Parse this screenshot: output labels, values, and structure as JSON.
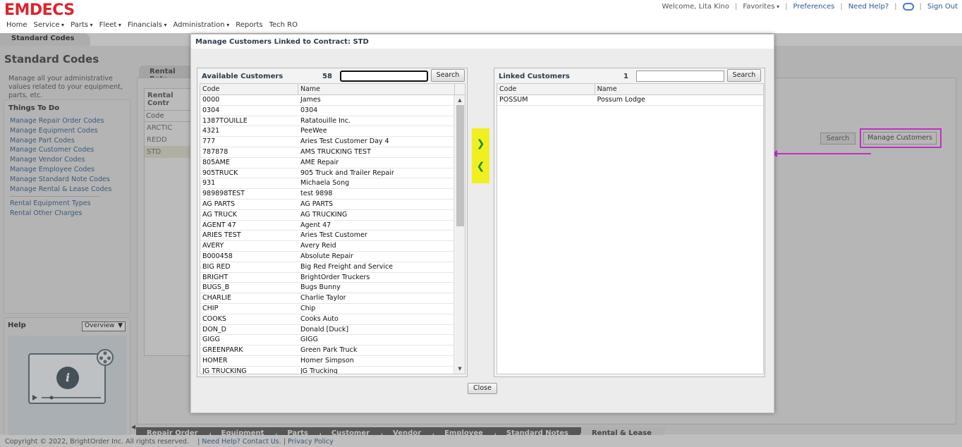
{
  "app": {
    "logo": "EMDECS",
    "nav": [
      {
        "label": "Home",
        "dropdown": false
      },
      {
        "label": "Service",
        "dropdown": true
      },
      {
        "label": "Parts",
        "dropdown": true
      },
      {
        "label": "Fleet",
        "dropdown": true
      },
      {
        "label": "Financials",
        "dropdown": true
      },
      {
        "label": "Administration",
        "dropdown": true
      },
      {
        "label": "Reports",
        "dropdown": false
      },
      {
        "label": "Tech RO",
        "dropdown": false
      }
    ],
    "user": {
      "welcome": "Welcome, Lita Kino",
      "favorites": "Favorites",
      "preferences": "Preferences",
      "need_help": "Need Help?",
      "sign_out": "Sign Out",
      "sep": "|"
    }
  },
  "page": {
    "tab": "Standard Codes",
    "title": "Standard Codes",
    "description": "Manage all your administrative values related to your equipment, parts, etc.",
    "things_to_do": {
      "heading": "Things To Do",
      "links": [
        "Manage Repair Order Codes",
        "Manage Equipment Codes",
        "Manage Part Codes",
        "Manage Customer Codes",
        "Manage Vendor Codes",
        "Manage Employee Codes",
        "Manage Standard Note Codes",
        "Manage Rental & Lease Codes"
      ],
      "links2": [
        "Rental Equipment Types",
        "Rental Other Charges"
      ]
    },
    "help": {
      "title": "Help",
      "select_value": "Overview"
    },
    "rate_tab": "Rental Rate",
    "contract_list": {
      "heading": "Rental Contr",
      "column": "Code",
      "rows": [
        "ARCTIC",
        "REDD",
        "STD"
      ],
      "selected_index": 2
    },
    "search_label": "Search",
    "manage_customers_label": "Manage Customers",
    "bottom_tabs": [
      "Repair Order",
      "Equipment",
      "Parts",
      "Customer",
      "Vendor",
      "Employee",
      "Standard Notes",
      "Rental & Lease"
    ],
    "bottom_tab_active": "Rental & Lease"
  },
  "footer": {
    "copyright": "Copyright © 2022, BrightOrder Inc. All rights reserved.",
    "contact": "Need Help? Contact Us.",
    "privacy": "Privacy Policy",
    "sep": "|"
  },
  "modal": {
    "title": "Manage Customers Linked to Contract: STD",
    "available": {
      "title": "Available Customers",
      "count": "58",
      "search_value": "",
      "search_label": "Search",
      "columns": [
        "Code",
        "Name"
      ],
      "rows": [
        [
          "0000",
          "James"
        ],
        [
          "0304",
          "0304"
        ],
        [
          "1387TOUILLE",
          "Ratatouille Inc."
        ],
        [
          "4321",
          "PeeWee"
        ],
        [
          "777",
          "Aries Test Customer Day 4"
        ],
        [
          "787878",
          "AMS TRUCKING TEST"
        ],
        [
          "805AME",
          "AME Repair"
        ],
        [
          "905TRUCK",
          "905 Truck and Trailer Repair"
        ],
        [
          "931",
          "Michaela Song"
        ],
        [
          "989898TEST",
          "test 9898"
        ],
        [
          "AG PARTS",
          "AG PARTS"
        ],
        [
          "AG TRUCK",
          "AG TRUCKING"
        ],
        [
          "AGENT 47",
          "Agent 47"
        ],
        [
          "ARIES TEST",
          "Aries Test Customer"
        ],
        [
          "AVERY",
          "Avery Reid"
        ],
        [
          "B000458",
          "Absolute Repair"
        ],
        [
          "BIG RED",
          "Big Red Freight and Service"
        ],
        [
          "BRIGHT",
          "BrightOrder Truckers"
        ],
        [
          "BUGS_B",
          "Bugs Bunny"
        ],
        [
          "CHARLIE",
          "Charlie Taylor"
        ],
        [
          "CHIP",
          "Chip"
        ],
        [
          "COOKS",
          "Cooks Auto"
        ],
        [
          "DON_D",
          "Donald [Duck]"
        ],
        [
          "GIGG",
          "GIGG"
        ],
        [
          "GREENPARK",
          "Green Park Truck"
        ],
        [
          "HOMER",
          "Homer Simpson"
        ],
        [
          "JG TRUCKING",
          "JG Trucking"
        ]
      ]
    },
    "linked": {
      "title": "Linked Customers",
      "count": "1",
      "search_value": "",
      "search_label": "Search",
      "columns": [
        "Code",
        "Name"
      ],
      "rows": [
        [
          "POSSUM",
          "Possum Lodge"
        ]
      ]
    },
    "move_right_icon": "chevron-right-icon",
    "move_left_icon": "chevron-left-icon",
    "close_label": "Close"
  },
  "colors": {
    "brand": "#d9262b",
    "highlight": "#e640e6",
    "move_bar": "#f0f020",
    "arrow_green": "#1a8a2a"
  }
}
